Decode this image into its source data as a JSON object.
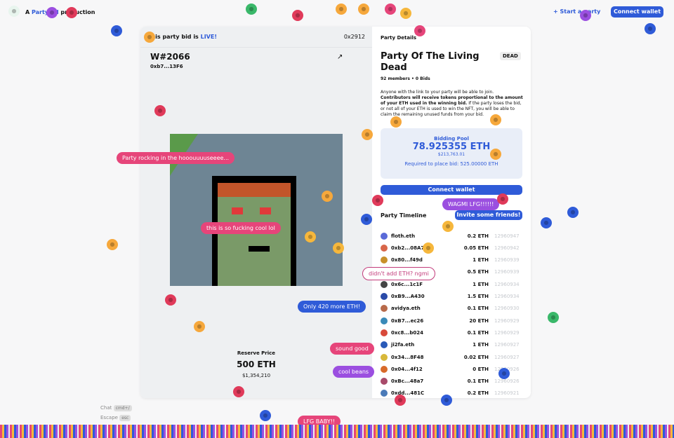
{
  "header": {
    "brand_prefix": "A ",
    "brand_name": "PartyBid",
    "brand_suffix": " production",
    "start_label": "+ Start a party",
    "connect_label": "Connect wallet"
  },
  "bid": {
    "status_prefix": "This party bid is ",
    "status_live": "LIVE!",
    "token_id": "0x2912",
    "title": "W#2066",
    "owner": "0xb7...13F6",
    "reserve_label": "Reserve Price",
    "reserve_value": "500 ETH",
    "reserve_usd": "$1,354,210",
    "nft_bg": "#6e8594"
  },
  "details": {
    "section_label": "Party Details",
    "title": "Party Of The Living Dead",
    "badge": "DEAD",
    "meta": "92 members • 0 Bids",
    "desc_1": "Anyone with the link to your party will be able to join. ",
    "desc_bold": "Contributors will receive tokens proportional to the amount of your ETH used in the winning bid.",
    "desc_2": " If the party loses the bid, or not all of your ETH is used to win the NFT, you will be able to claim the remaining unused funds from your bid.",
    "pool_label": "Bidding Pool",
    "pool_value": "78.925355 ETH",
    "pool_usd": "$213,763.01",
    "required": "Required to place bid: 525.00000 ETH",
    "connect_label": "Connect wallet",
    "timeline_label": "Party Timeline",
    "invite_label": "Invite some friends!"
  },
  "timeline": [
    {
      "name": "floth.eth",
      "amt": "0.2 ETH",
      "block": "12960947",
      "color": "#5a6ad8"
    },
    {
      "name": "0xb2...08A7",
      "amt": "0.05 ETH",
      "block": "12960942",
      "color": "#d8664a"
    },
    {
      "name": "0x80...f49d",
      "amt": "1 ETH",
      "block": "12960939",
      "color": "#c8902a"
    },
    {
      "name": "0x...",
      "amt": "0.5 ETH",
      "block": "12960939",
      "color": "#888"
    },
    {
      "name": "0x6c...1c1F",
      "amt": "1 ETH",
      "block": "12960934",
      "color": "#444"
    },
    {
      "name": "0xB9...A430",
      "amt": "1.5 ETH",
      "block": "12960934",
      "color": "#2a4aa8"
    },
    {
      "name": "avidya.eth",
      "amt": "0.1 ETH",
      "block": "12960930",
      "color": "#b86a4a"
    },
    {
      "name": "0xB7...ec26",
      "amt": "20 ETH",
      "block": "12960929",
      "color": "#3a8ab8"
    },
    {
      "name": "0xc8...b024",
      "amt": "0.1 ETH",
      "block": "12960929",
      "color": "#d84a3a"
    },
    {
      "name": "ji2fa.eth",
      "amt": "1 ETH",
      "block": "12960927",
      "color": "#2a5ab8"
    },
    {
      "name": "0x34...8F48",
      "amt": "0.02 ETH",
      "block": "12960927",
      "color": "#d8b83a"
    },
    {
      "name": "0x04...4f12",
      "amt": "0 ETH",
      "block": "12960926",
      "color": "#d86a2a"
    },
    {
      "name": "0xBc...48a7",
      "amt": "0.1 ETH",
      "block": "12960926",
      "color": "#a84a6a"
    },
    {
      "name": "0xdd...481C",
      "amt": "0.2 ETH",
      "block": "12960921",
      "color": "#4a7ab8"
    }
  ],
  "chat": [
    {
      "text": "Party rocking in the hooouuuuseeee...",
      "color": "#e6457a"
    },
    {
      "text": "this is so fucking cool lol",
      "color": "#e6457a"
    },
    {
      "text": "WAGMI LFG!!!!!!",
      "color": "#9b4fe0"
    },
    {
      "text": "didn't add ETH? ngmi",
      "color": "#ffffff"
    },
    {
      "text": "Only 420 more ETH!",
      "color": "#2f5bd8"
    },
    {
      "text": "sound good",
      "color": "#e6457a"
    },
    {
      "text": "cool beans",
      "color": "#9b4fe0"
    },
    {
      "text": "LFG BABY!!",
      "color": "#e6457a"
    }
  ],
  "shortcuts": {
    "chat": "Chat",
    "chat_key": "cmd+/",
    "escape": "Escape",
    "escape_key": "esc"
  }
}
